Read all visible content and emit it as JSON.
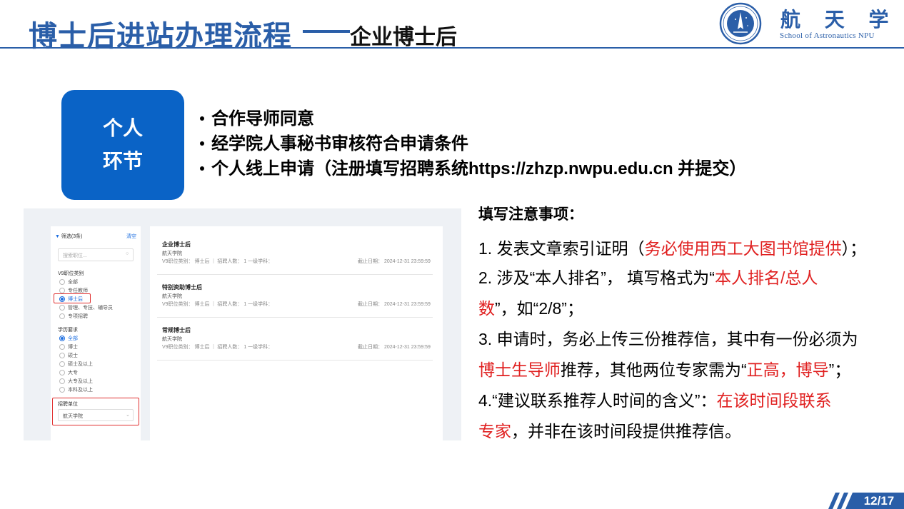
{
  "header": {
    "title": "博士后进站办理流程",
    "subtitle": "企业博士后",
    "logo_cn": "航 天 学 院",
    "logo_en": "School of Astronautics NPU",
    "seal_text": "School of Astronautics NPU",
    "accent_color": "#2a5ea8"
  },
  "stage": {
    "line1": "个人",
    "line2": "环节",
    "color": "#0a63c6"
  },
  "bullets": [
    "合作导师同意",
    "经学院人事秘书审核符合申请条件",
    "个人线上申请（注册填写招聘系统https://zhzp.nwpu.edu.cn 并提交）"
  ],
  "mock": {
    "filter_title": "筛选(3条)",
    "reset": "清空",
    "search_placeholder": "搜索职位...",
    "category_title": "V9职位类别",
    "categories": [
      "全部",
      "专任教师",
      "博士后",
      "管理、专技、辅导员",
      "专项招聘"
    ],
    "edu_title": "学历要求",
    "edu_options": [
      "全部",
      "博士",
      "硕士",
      "硕士及以上",
      "大专",
      "大专及以上",
      "本科及以上"
    ],
    "unit_title": "招聘单位",
    "unit_value": "航天学院",
    "jobs": [
      {
        "title": "企业博士后",
        "org": "航天学院",
        "meta": "V9职位类别： 博士后  ｜  招聘人数： 1 一级学科：",
        "deadline": "截止日期： 2024-12-31 23:59:59"
      },
      {
        "title": "特别资助博士后",
        "org": "航天学院",
        "meta": "V9职位类别： 博士后  ｜  招聘人数： 1 一级学科：",
        "deadline": "截止日期： 2024-12-31 23:59:59"
      },
      {
        "title": "常规博士后",
        "org": "航天学院",
        "meta": "V9职位类别： 博士后  ｜  招聘人数： 1 一级学科：",
        "deadline": "截止日期： 2024-12-31 23:59:59"
      }
    ]
  },
  "notes": {
    "title": "填写注意事项：",
    "n1_a": "1. 发表文章索引证明（",
    "n1_b": "务必使用西工大图书馆提供",
    "n1_c": "）；",
    "n2_a": "2. 涉及“本人排名”， 填写格式为“",
    "n2_b": "本人排名/总人",
    "n2_c": "数",
    "n2_d": "”，如“2/8”；",
    "n3_a": "3. 申请时，务必上传三份推荐信，其中有一份必须为",
    "n3_b": "博士生导师",
    "n3_c": "推荐，其他两位专家需为“",
    "n3_d": "正高，博导",
    "n3_e": "”；",
    "n4_a": "4.“建议联系推荐人时间的含义”：",
    "n4_b": "在该时间段联系",
    "n4_c": "专家",
    "n4_d": "，并非在该时间段提供推荐信。",
    "highlight_color": "#e02020"
  },
  "footer": {
    "page": "12/17"
  }
}
